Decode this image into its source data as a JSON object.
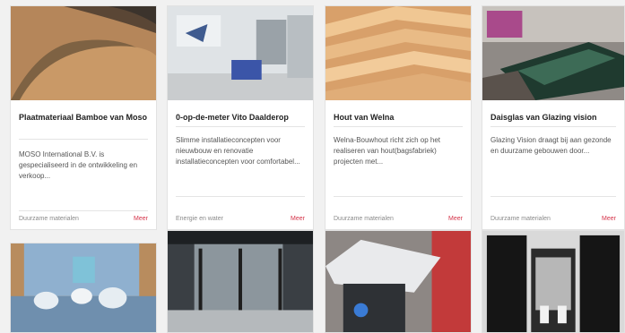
{
  "cards": [
    {
      "title": "Plaatmateriaal Bamboe van Moso",
      "description": "MOSO International B.V. is gespecialiseerd in de ontwikkeling en verkoop...",
      "category": "Duurzame materialen",
      "more": "Meer"
    },
    {
      "title": "0-op-de-meter Vito Daalderop",
      "description": "Slimme installatieconcepten voor nieuwbouw en renovatie installatieconcepten voor comfortabel...",
      "category": "Energie en water",
      "more": "Meer"
    },
    {
      "title": "Hout van Welna",
      "description": "Welna-Bouwhout richt zich op het realiseren van hout(bagsfabriek) projecten met...",
      "category": "Duurzame materialen",
      "more": "Meer"
    },
    {
      "title": "Daisglas van Glazing vision",
      "description": "Glazing Vision draagt bij aan gezonde en duurzame gebouwen door...",
      "category": "Duurzame materialen",
      "more": "Meer"
    }
  ],
  "bottom_cards": [
    {
      "image": "lab-samples-photo"
    },
    {
      "image": "glass-wall-showroom-photo"
    },
    {
      "image": "white-panel-device-photo"
    },
    {
      "image": "black-panels-photo"
    }
  ],
  "colors": {
    "accent": "#d5344a",
    "background": "#f1f1f1",
    "card": "#ffffff"
  }
}
